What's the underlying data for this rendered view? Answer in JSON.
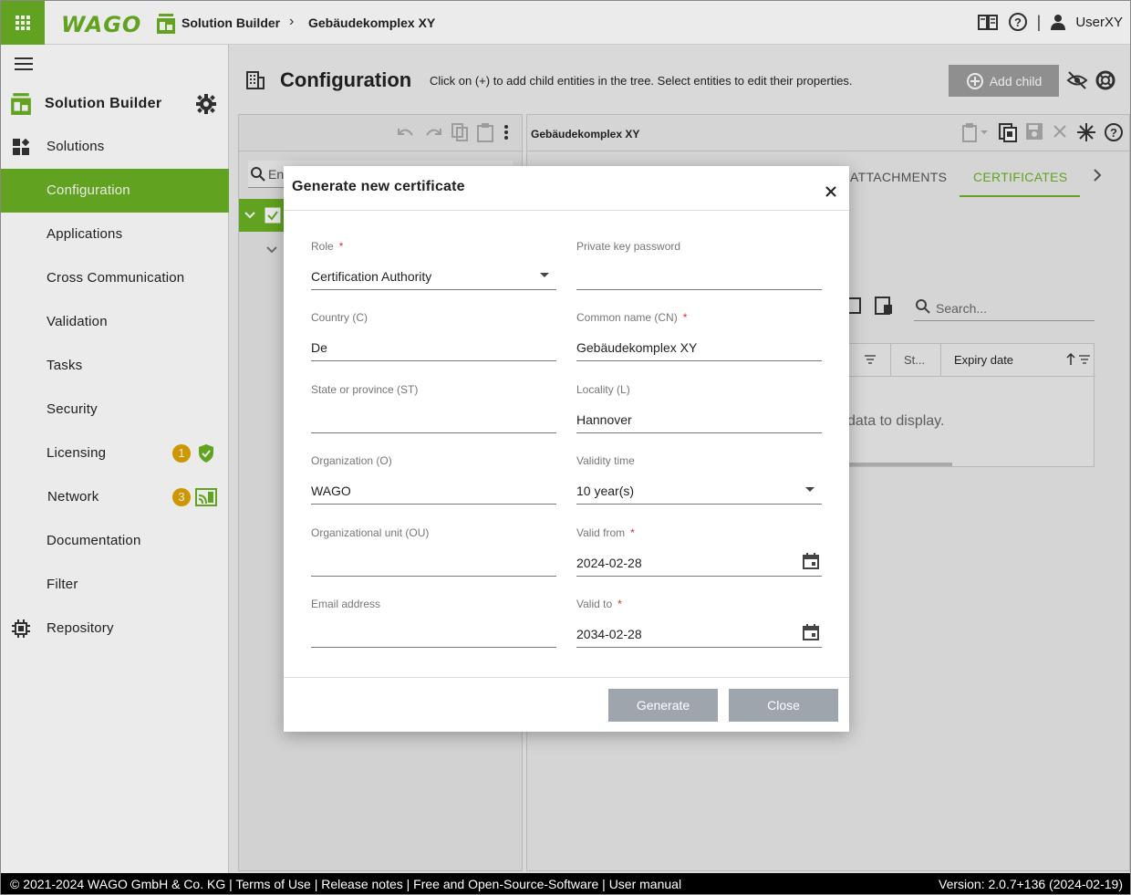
{
  "topbar": {
    "logo": "WAGO",
    "breadcrumb": [
      "Solution Builder",
      "Gebäudekomplex XY"
    ],
    "user": "UserXY"
  },
  "sidebar": {
    "title": "Solution Builder",
    "items": [
      {
        "label": "Solutions"
      },
      {
        "label": "Configuration"
      },
      {
        "label": "Applications"
      },
      {
        "label": "Cross Communication"
      },
      {
        "label": "Validation"
      },
      {
        "label": "Tasks"
      },
      {
        "label": "Security"
      },
      {
        "label": "Licensing",
        "badge": "1"
      },
      {
        "label": "Network",
        "badge": "3"
      },
      {
        "label": "Documentation"
      },
      {
        "label": "Filter"
      },
      {
        "label": "Repository"
      }
    ],
    "active_index": 1
  },
  "config": {
    "title": "Configuration",
    "description": "Click on (+) to add child entities in the tree. Select entities to edit their properties.",
    "add_child_label": "Add child"
  },
  "tree": {
    "search_placeholder": "En"
  },
  "detail": {
    "title": "Gebäudekomplex XY",
    "tabs": [
      "ATTACHMENTS",
      "CERTIFICATES"
    ],
    "active_tab": "CERTIFICATES",
    "search_placeholder": "Search...",
    "columns": [
      "St...",
      "Expiry date"
    ],
    "no_data": "data to display."
  },
  "dialog": {
    "title": "Generate new certificate",
    "fields": {
      "role": {
        "label": "Role",
        "value": "Certification Authority",
        "required": true
      },
      "private_key_password": {
        "label": "Private key password",
        "value": ""
      },
      "country": {
        "label": "Country (C)",
        "value": "De"
      },
      "common_name": {
        "label": "Common name (CN)",
        "value": "Gebäudekomplex XY",
        "required": true
      },
      "state": {
        "label": "State or province (ST)",
        "value": ""
      },
      "locality": {
        "label": "Locality (L)",
        "value": "Hannover"
      },
      "organization": {
        "label": "Organization (O)",
        "value": "WAGO"
      },
      "validity_time": {
        "label": "Validity time",
        "value": "10 year(s)"
      },
      "org_unit": {
        "label": "Organizational unit (OU)",
        "value": ""
      },
      "valid_from": {
        "label": "Valid from",
        "value": "2024-02-28",
        "required": true
      },
      "email": {
        "label": "Email address",
        "value": ""
      },
      "valid_to": {
        "label": "Valid to",
        "value": "2034-02-28",
        "required": true
      }
    },
    "required_marker": "*",
    "generate_label": "Generate",
    "close_label": "Close"
  },
  "footer": {
    "left": "© 2021-2024 WAGO GmbH & Co. KG | Terms of Use | Release notes | Free and Open-Source-Software | User manual",
    "right": "Version: 2.0.7+136 (2024-02-19)"
  },
  "colors": {
    "accent": "#6ab023",
    "badge": "#e0a400",
    "button_disabled": "#9ea5ad",
    "footer_bg": "#000000"
  }
}
